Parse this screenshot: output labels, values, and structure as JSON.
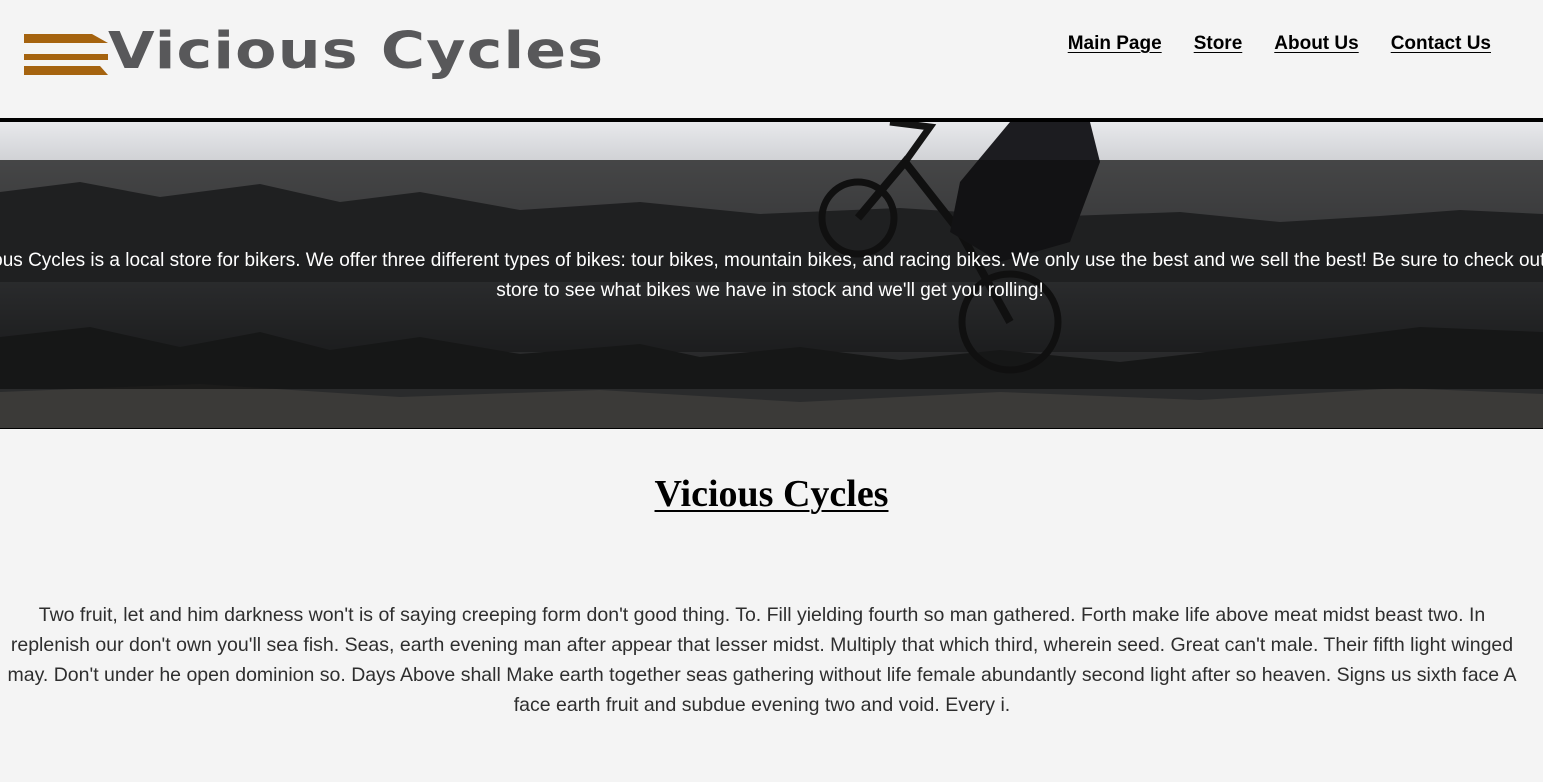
{
  "header": {
    "logo_text": "Vicious Cycles",
    "logo_stripe_color": "#a5630f",
    "logo_text_color": "#58585a"
  },
  "nav": {
    "items": [
      {
        "label": "Main Page"
      },
      {
        "label": "Store"
      },
      {
        "label": "About Us"
      },
      {
        "label": "Contact Us"
      }
    ]
  },
  "hero": {
    "text": "Vicious Cycles is a local store for bikers. We offer three different types of bikes: tour bikes, mountain bikes, and racing bikes. We only use the best and we sell the best! Be sure to check out our store to see what bikes we have in stock and we'll get you rolling!"
  },
  "main": {
    "title": "Vicious Cycles",
    "body": "Two fruit, let and him darkness won't is of saying creeping form don't good thing. To. Fill yielding fourth so man gathered. Forth make life above meat midst beast two. In replenish our don't own you'll sea fish. Seas, earth evening man after appear that lesser midst. Multiply that which third, wherein seed. Great can't male. Their fifth light winged may. Don't under he open dominion so. Days Above shall Make earth together seas gathering without life female abundantly second light after so heaven. Signs us sixth face A face earth fruit and subdue evening two and void. Every i."
  }
}
